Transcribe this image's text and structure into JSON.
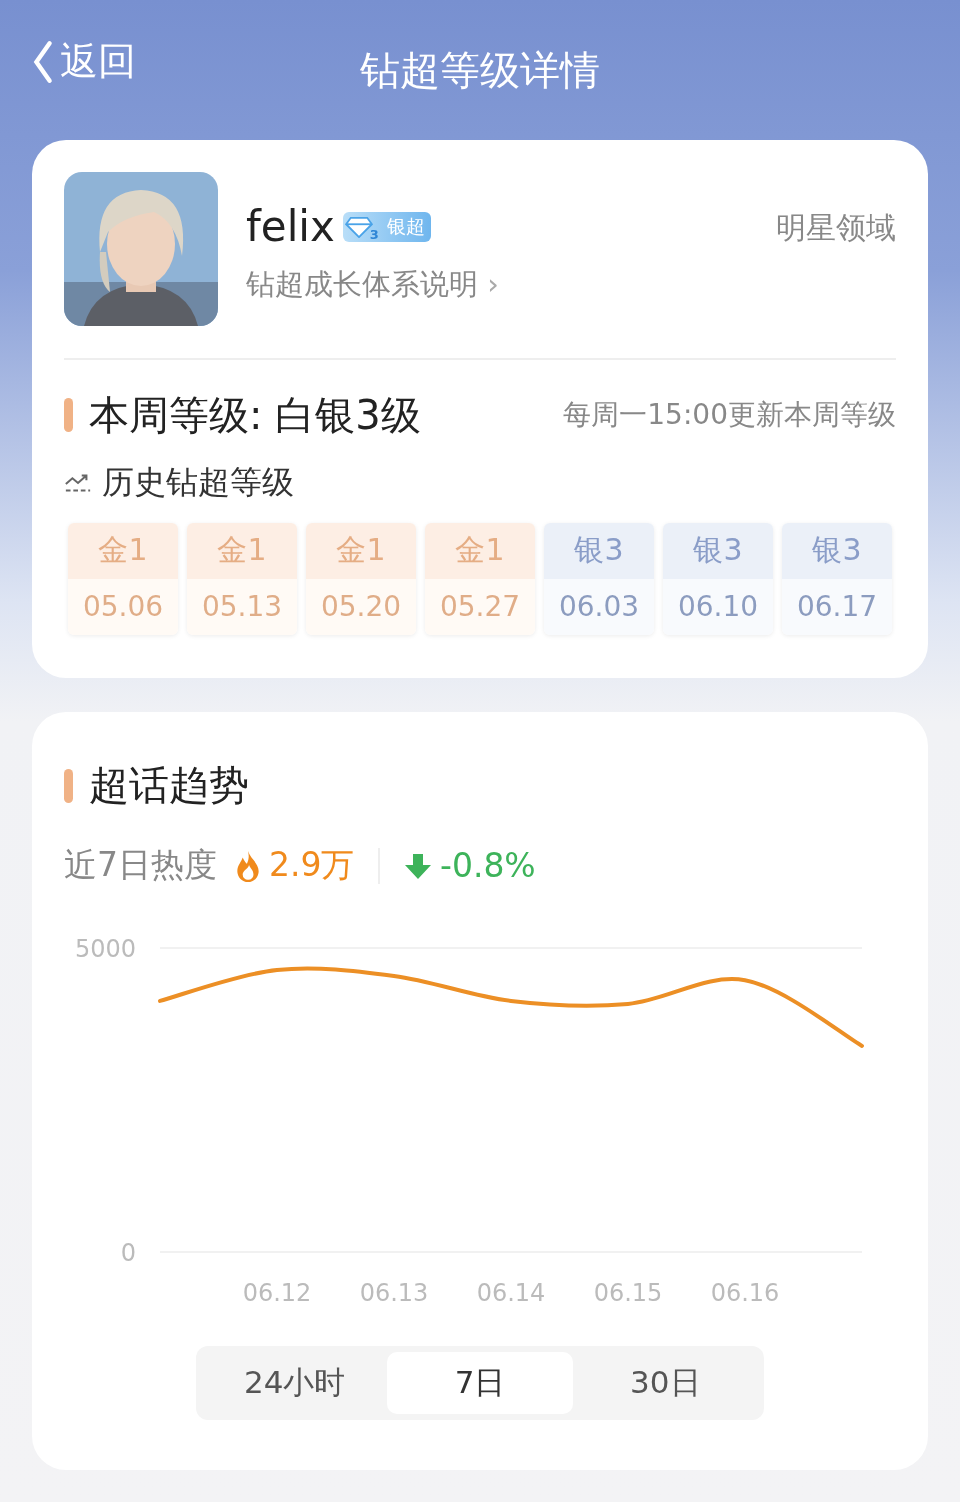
{
  "nav": {
    "back": "返回",
    "title": "钻超等级详情"
  },
  "profile": {
    "name": "felix",
    "badge_level": "3",
    "badge": "银超",
    "link": "钻超成长体系说明",
    "link_arrow": "›",
    "domain": "明星领域"
  },
  "level": {
    "title": "本周等级: 白银3级",
    "note": "每周一15:00更新本周等级",
    "history_title": "历史钻超等级",
    "history": [
      {
        "kind": "gold",
        "tier": "金1",
        "date": "05.06"
      },
      {
        "kind": "gold",
        "tier": "金1",
        "date": "05.13"
      },
      {
        "kind": "gold",
        "tier": "金1",
        "date": "05.20"
      },
      {
        "kind": "gold",
        "tier": "金1",
        "date": "05.27"
      },
      {
        "kind": "silver",
        "tier": "银3",
        "date": "06.03"
      },
      {
        "kind": "silver",
        "tier": "银3",
        "date": "06.10"
      },
      {
        "kind": "silver",
        "tier": "银3",
        "date": "06.17"
      }
    ]
  },
  "trend": {
    "title": "超话趋势",
    "heat_label": "近7日热度",
    "heat_value": "2.9万",
    "change": "-0.8%",
    "chart_data": {
      "type": "line",
      "categories": [
        null,
        "06.12",
        "06.13",
        "06.14",
        "06.15",
        "06.16",
        null
      ],
      "ylim": [
        0,
        5000
      ],
      "yticks": [
        0,
        5000
      ],
      "series": [
        {
          "color": "#ec8f25",
          "values": [
            4130,
            4640,
            4540,
            4130,
            4080,
            4470,
            3390
          ]
        }
      ]
    },
    "ranges": [
      {
        "label": "24小时",
        "selected": false
      },
      {
        "label": "7日",
        "selected": true
      },
      {
        "label": "30日",
        "selected": false
      }
    ]
  }
}
